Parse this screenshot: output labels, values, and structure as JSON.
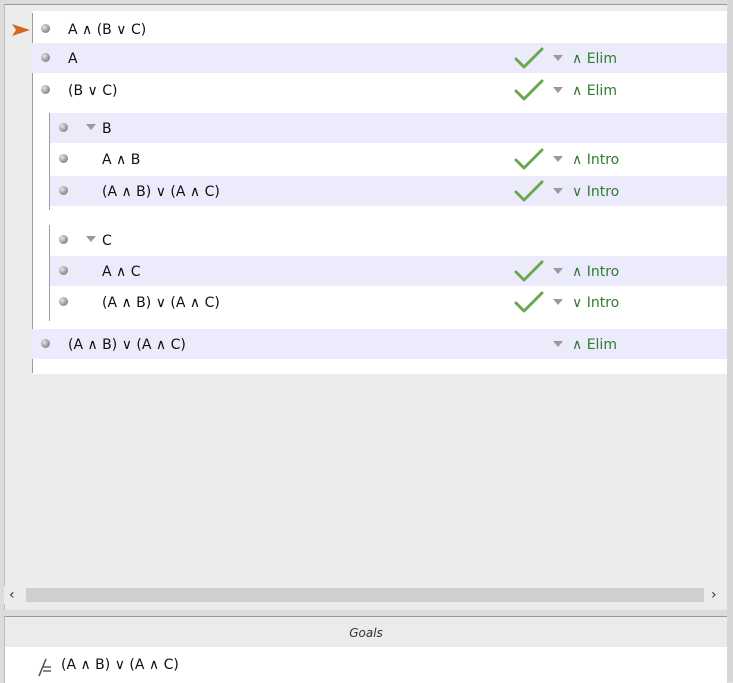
{
  "proof": {
    "premise": "A ∧ (B ∨ C)",
    "lines": [
      {
        "formula": "A",
        "rule": "∧ Elim"
      },
      {
        "formula": "(B ∨ C)",
        "rule": "∧ Elim"
      },
      {
        "formula": "B"
      },
      {
        "formula": "A ∧ B",
        "rule": "∧ Intro"
      },
      {
        "formula": "(A ∧ B) ∨ (A ∧ C)",
        "rule": "∨ Intro"
      },
      {
        "formula": "C"
      },
      {
        "formula": "A ∧ C",
        "rule": "∧ Intro"
      },
      {
        "formula": "(A ∧ B) ∨ (A ∧ C)",
        "rule": "∨ Intro"
      },
      {
        "formula": "(A ∧ B) ∨ (A ∧ C)",
        "rule": "∧ Elim"
      }
    ]
  },
  "scrollbar": {
    "left": "‹",
    "right": "›"
  },
  "goals": {
    "title": "Goals",
    "formula": "(A ∧ B) ∨ (A ∧ C)"
  },
  "colors": {
    "accent_rule": "#2f7d2f",
    "check": "#6aa84f",
    "current_arrow": "#d2691e",
    "row_shade": "#ebebfb"
  }
}
